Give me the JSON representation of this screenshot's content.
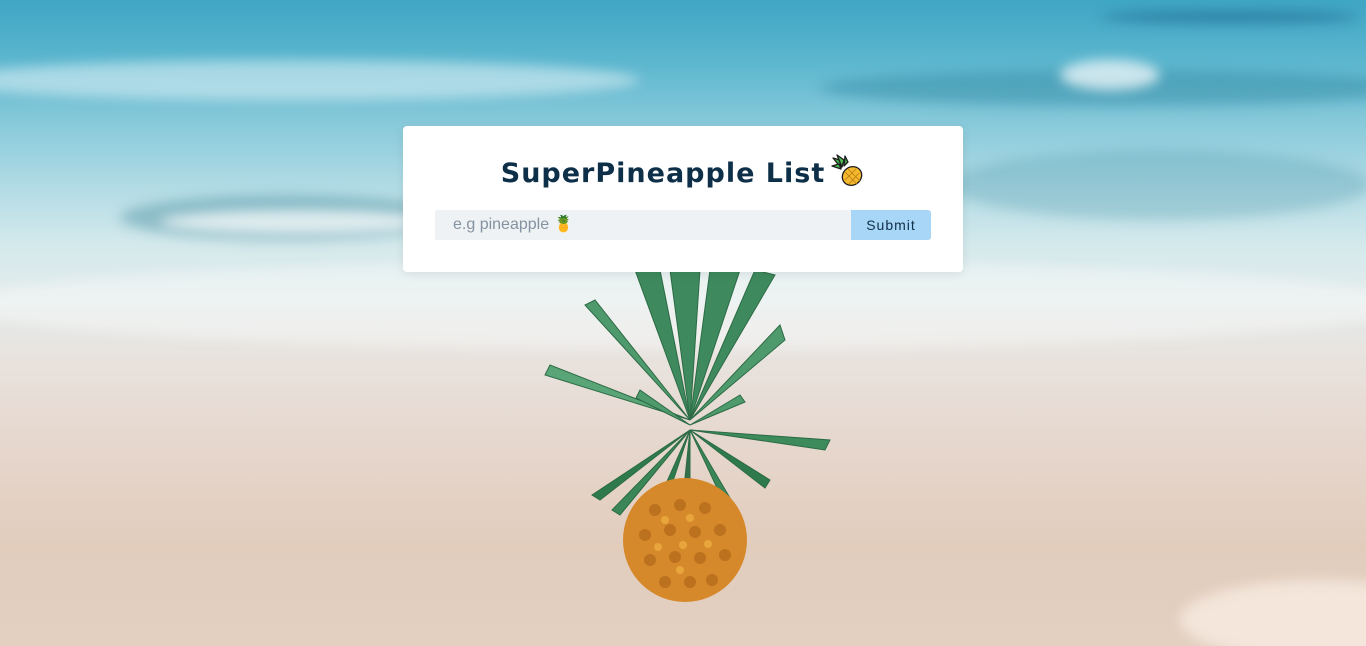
{
  "app": {
    "title": "SuperPineapple List",
    "title_icon": "pineapple-icon"
  },
  "form": {
    "input_placeholder": "e.g pineapple 🍍",
    "input_value": "",
    "submit_label": "Submit"
  },
  "colors": {
    "title": "#0e2f48",
    "card": "#ffffff",
    "input_bg": "#eef2f5",
    "submit_bg": "#a8d6f6"
  },
  "background": {
    "subject": "pineapple-on-beach-image"
  }
}
